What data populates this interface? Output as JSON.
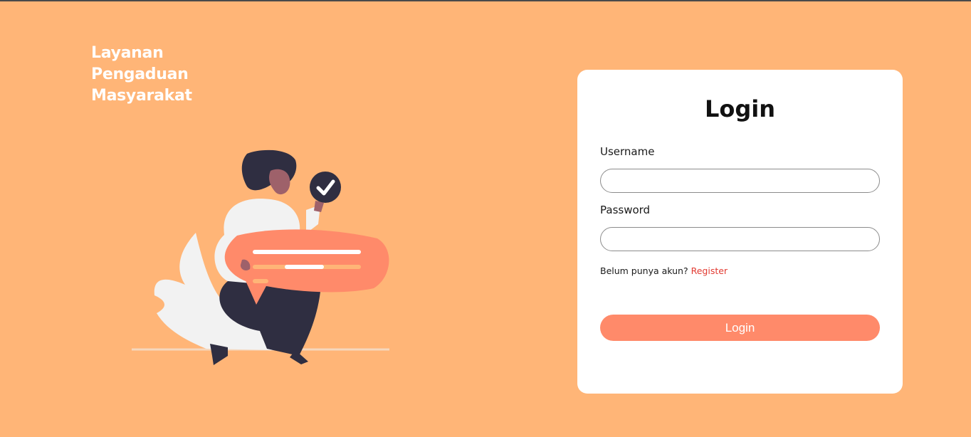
{
  "brand": {
    "line1": "Layanan",
    "line2": "Pengaduan",
    "line3": "Masyarakat"
  },
  "login_card": {
    "title": "Login",
    "username_label": "Username",
    "username_value": "",
    "password_label": "Password",
    "password_value": "",
    "register_prompt": "Belum punya akun?",
    "register_link": "Register",
    "submit_label": "Login"
  },
  "colors": {
    "background": "#FFB577",
    "card": "#FFFFFF",
    "accent": "#FF8A6A",
    "link": "#E23B32"
  },
  "icons": {
    "illustration": "person-with-checkmark-and-message-illustration",
    "check": "check-icon"
  }
}
